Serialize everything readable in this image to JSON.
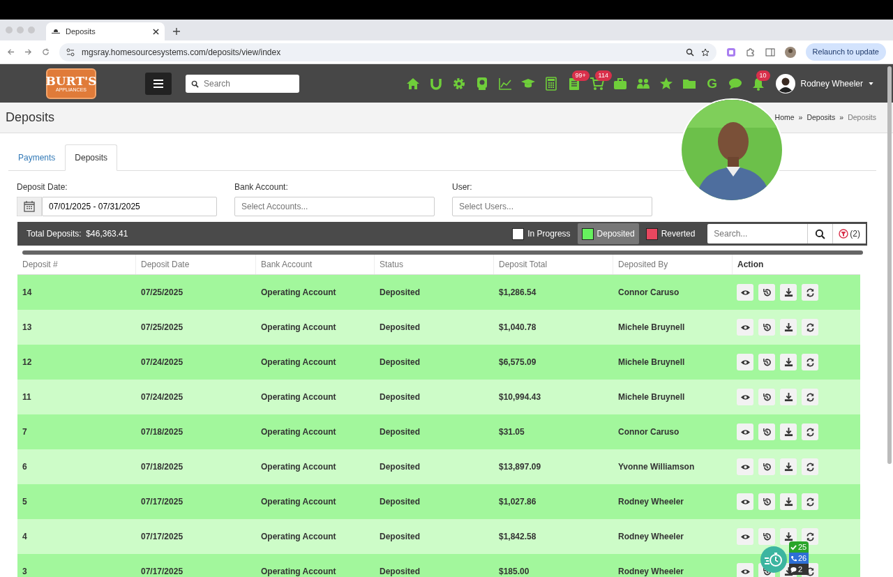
{
  "browser": {
    "tab_title": "Deposits",
    "url": "mgsray.homesourcesystems.com/deposits/view/index",
    "update_button": "Relaunch to update"
  },
  "app_header": {
    "logo": {
      "title": "BURT'S",
      "subtitle": "APPLIANCES"
    },
    "search_placeholder": "Search",
    "g_label": "G",
    "badges": [
      {
        "text": "99+"
      },
      {
        "text": "114"
      },
      {
        "text": "10"
      }
    ],
    "user_name": "Rodney Wheeler"
  },
  "page": {
    "title": "Deposits",
    "separator": "»",
    "breadcrumb": [
      {
        "label": "Home"
      },
      {
        "label": "Deposits"
      },
      {
        "label": "Deposits"
      }
    ]
  },
  "tabs": [
    {
      "label": "Payments",
      "selected": false
    },
    {
      "label": "Deposits",
      "selected": true
    }
  ],
  "filters": [
    {
      "kind": "date",
      "label": "Deposit Date:",
      "value": "07/01/2025 - 07/31/2025"
    },
    {
      "kind": "select",
      "label": "Bank Account:",
      "placeholder": "Select Accounts..."
    },
    {
      "kind": "select",
      "label": "User:",
      "placeholder": "Select Users..."
    }
  ],
  "toolbar": {
    "total_label": "Total Deposits:",
    "total_value": "$46,363.41",
    "search_placeholder": "Search...",
    "filter_count": "(2)",
    "legend": [
      {
        "label": "In Progress",
        "color": "#ffffff",
        "selected": false
      },
      {
        "label": "Deposited",
        "color": "#66f25e",
        "selected": true
      },
      {
        "label": "Reverted",
        "color": "#e8475f",
        "selected": false
      }
    ]
  },
  "table": {
    "columns": [
      "Deposit #",
      "Deposit Date",
      "Bank Account",
      "Status",
      "Deposit Total",
      "Deposited By",
      "Action"
    ],
    "rows": [
      {
        "kind": "deposited",
        "cells": [
          "14",
          "07/25/2025",
          "Operating Account",
          "Deposited",
          "$1,286.54",
          "Connor Caruso"
        ]
      },
      {
        "kind": "deposited",
        "cells": [
          "13",
          "07/25/2025",
          "Operating Account",
          "Deposited",
          "$1,040.78",
          "Michele Bruynell"
        ]
      },
      {
        "kind": "deposited",
        "cells": [
          "12",
          "07/24/2025",
          "Operating Account",
          "Deposited",
          "$6,575.09",
          "Michele Bruynell"
        ]
      },
      {
        "kind": "deposited",
        "cells": [
          "11",
          "07/24/2025",
          "Operating Account",
          "Deposited",
          "$10,994.43",
          "Michele Bruynell"
        ]
      },
      {
        "kind": "deposited",
        "cells": [
          "7",
          "07/18/2025",
          "Operating Account",
          "Deposited",
          "$31.05",
          "Connor Caruso"
        ]
      },
      {
        "kind": "deposited",
        "cells": [
          "6",
          "07/18/2025",
          "Operating Account",
          "Deposited",
          "$13,897.09",
          "Yvonne Williamson"
        ]
      },
      {
        "kind": "deposited",
        "cells": [
          "5",
          "07/17/2025",
          "Operating Account",
          "Deposited",
          "$1,027.86",
          "Rodney Wheeler"
        ]
      },
      {
        "kind": "deposited",
        "cells": [
          "4",
          "07/17/2025",
          "Operating Account",
          "Deposited",
          "$1,842.58",
          "Rodney Wheeler"
        ]
      },
      {
        "kind": "deposited",
        "cells": [
          "3",
          "07/17/2025",
          "Operating Account",
          "Deposited",
          "$185.00",
          "Rodney Wheeler"
        ]
      }
    ]
  },
  "widget": {
    "counters": [
      {
        "kind": "done",
        "text": "25"
      },
      {
        "kind": "call",
        "text": "26"
      },
      {
        "kind": "chat",
        "text": "2"
      }
    ]
  }
}
